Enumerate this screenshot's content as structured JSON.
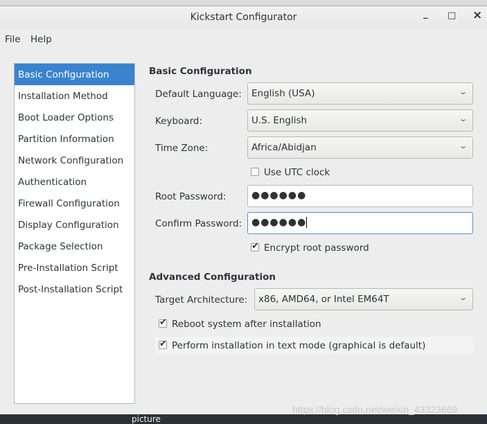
{
  "window": {
    "title": "Kickstart Configurator",
    "minimize": "_",
    "maximize": "□",
    "close": "×"
  },
  "menu": [
    "File",
    "Help"
  ],
  "sidebar": {
    "selected": 0,
    "items": [
      "Basic Configuration",
      "Installation Method",
      "Boot Loader Options",
      "Partition Information",
      "Network Configuration",
      "Authentication",
      "Firewall Configuration",
      "Display Configuration",
      "Package Selection",
      "Pre-Installation Script",
      "Post-Installation Script"
    ]
  },
  "basic": {
    "header": "Basic Configuration",
    "language_label": "Default Language:",
    "language": "English (USA)",
    "keyboard_label": "Keyboard:",
    "keyboard": "U.S. English",
    "timezone_label": "Time Zone:",
    "timezone": "Africa/Abidjan",
    "utc_label": "Use UTC clock",
    "utc_checked": false,
    "root_label": "Root Password:",
    "root_value": "●●●●●●",
    "confirm_label": "Confirm Password:",
    "confirm_value": "●●●●●●",
    "encrypt_label": "Encrypt root password",
    "encrypt_checked": true
  },
  "advanced": {
    "header": "Advanced Configuration",
    "arch_label": "Target Architecture:",
    "arch": "x86, AMD64, or Intel EM64T",
    "reboot_label": "Reboot system after installation",
    "reboot_checked": true,
    "textmode_label": "Perform installation in text mode (graphical is default)",
    "textmode_checked": true
  },
  "watermark": "https://blog.csdn.net/weixin_43323669",
  "desktop_text": "picture",
  "colors": {
    "selection": "#3a83cf",
    "focus": "#4a90d9"
  }
}
